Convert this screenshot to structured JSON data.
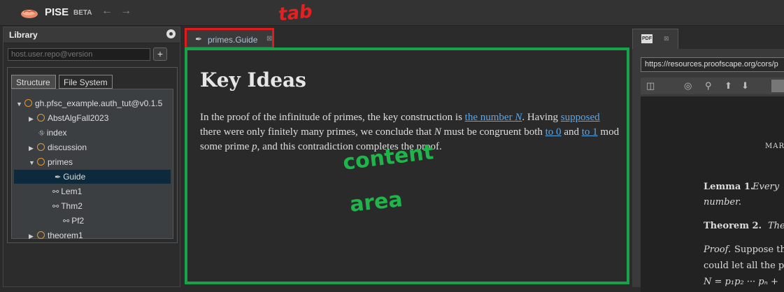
{
  "app": {
    "name": "PISE",
    "badge": "BETA",
    "back_icon": "←",
    "forward_icon": "→"
  },
  "annotations": {
    "tab": "tab",
    "content": "content",
    "area": "area"
  },
  "library": {
    "title": "Library",
    "repo_placeholder": "host.user.repo@version",
    "add_label": "+",
    "tabs": [
      "Structure",
      "File System"
    ],
    "tree": [
      {
        "label": "gh.pfsc_example.auth_tut@v0.1.5",
        "expander": "▼"
      },
      {
        "label": "AbstAlgFall2023",
        "expander": "▶"
      },
      {
        "label": "index",
        "icon": "⛗"
      },
      {
        "label": "discussion",
        "expander": "▶"
      },
      {
        "label": "primes",
        "expander": "▼"
      },
      {
        "label": "Guide",
        "icon": "✒"
      },
      {
        "label": "Lem1",
        "icon": "⚯"
      },
      {
        "label": "Thm2",
        "icon": "⚯"
      },
      {
        "label": "Pf2",
        "icon": "⚯"
      },
      {
        "label": "theorem1",
        "expander": "▶"
      }
    ]
  },
  "content": {
    "tab_label": "primes.Guide",
    "tab_close": "⊠",
    "title": "Key Ideas",
    "p1": "In the proof of the infinitude of primes, the key construction is ",
    "link1": "the number ",
    "link1_var": "N",
    "p2": ". Having ",
    "link2": "supposed",
    "p3": " there were only finitely many primes, we conclude that ",
    "var_n": "N",
    "p4": " must be congruent both ",
    "link3": "to 0",
    "p5": " and ",
    "link4": "to 1",
    "p6": " mod some prime ",
    "var_p": "p",
    "p7": ", and this contradiction completes the proof."
  },
  "pdf": {
    "badge": "PDF",
    "tab_close": "⊠",
    "url": "https://resources.proofscape.org/cors/p",
    "lines": {
      "header": "MAR",
      "lemma_label": "Lemma 1.",
      "lemma_text": "Every",
      "lemma_text2": "number.",
      "thm_label": "Theorem 2.",
      "thm_text": "The",
      "proof_label": "Proof.",
      "proof_text": "Suppose th",
      "proof_text2": "could let all the p",
      "proof_text3": "N = p₁p₂ ··· pₙ +"
    }
  }
}
